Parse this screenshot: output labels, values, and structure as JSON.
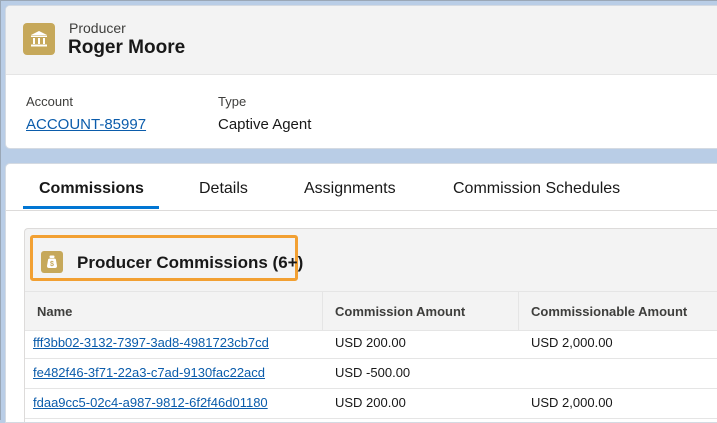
{
  "header": {
    "object_type": "Producer",
    "record_name": "Roger Moore",
    "icon": "bank-icon",
    "fields": [
      {
        "label": "Account",
        "value": "ACCOUNT-85997",
        "is_link": true
      },
      {
        "label": "Type",
        "value": "Captive Agent",
        "is_link": false
      }
    ]
  },
  "tabs": [
    {
      "label": "Commissions",
      "active": true
    },
    {
      "label": "Details",
      "active": false
    },
    {
      "label": "Assignments",
      "active": false
    },
    {
      "label": "Commission Schedules",
      "active": false
    }
  ],
  "related_list": {
    "icon": "money-bag-icon",
    "title": "Producer Commissions (6+)",
    "columns": [
      "Name",
      "Commission Amount",
      "Commissionable Amount"
    ],
    "rows": [
      {
        "name": "fff3bb02-3132-7397-3ad8-4981723cb7cd",
        "commission_amount": "USD 200.00",
        "commissionable_amount": "USD 2,000.00"
      },
      {
        "name": "fe482f46-3f71-22a3-c7ad-9130fac22acd",
        "commission_amount": "USD -500.00",
        "commissionable_amount": ""
      },
      {
        "name": "fdaa9cc5-02c4-a987-9812-6f2f46d01180",
        "commission_amount": "USD 200.00",
        "commissionable_amount": "USD 2,000.00"
      }
    ]
  },
  "colors": {
    "accent": "#0176d3",
    "link": "#0b5cab",
    "object_icon": "#c6a85a",
    "highlight": "#f2a032",
    "page_background": "#b9cde6"
  }
}
